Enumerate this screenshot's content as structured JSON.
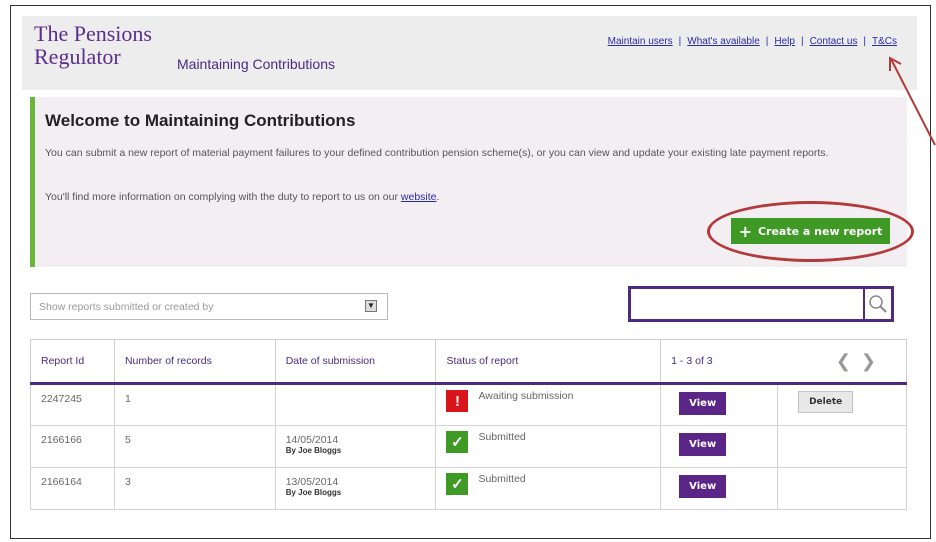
{
  "header": {
    "logo_line1": "The Pensions",
    "logo_line2": "Regulator",
    "app_title": "Maintaining Contributions",
    "links": [
      "Maintain users",
      "What's available",
      "Help",
      "Contact us",
      "T&Cs"
    ]
  },
  "welcome": {
    "title": "Welcome to Maintaining Contributions",
    "para1": "You can submit a new report of material payment failures to your defined contribution pension scheme(s), or you can view and update your existing late payment reports.",
    "para2_text": "You'll find more information on complying with the duty to report to us on our ",
    "para2_link": "website",
    "para2_end": ".",
    "create_button": "Create a new report"
  },
  "filter": {
    "placeholder": "Show reports submitted or created by"
  },
  "table": {
    "headers": [
      "Report Id",
      "Number of records",
      "Date of submission",
      "Status of report"
    ],
    "pager": "1 - 3 of 3",
    "rows": [
      {
        "id": "2247245",
        "records": "1",
        "date": "",
        "by": "",
        "status": "Awaiting submission",
        "status_type": "error",
        "view": "View",
        "delete": "Delete"
      },
      {
        "id": "2166166",
        "records": "5",
        "date": "14/05/2014",
        "by": "By Joe Bloggs",
        "status": "Submitted",
        "status_type": "ok",
        "view": "View"
      },
      {
        "id": "2166164",
        "records": "3",
        "date": "13/05/2014",
        "by": "By Joe Bloggs",
        "status": "Submitted",
        "status_type": "ok",
        "view": "View"
      }
    ]
  },
  "colors": {
    "brand_purple": "#4b2a7f",
    "accent_green": "#3e9a24",
    "alert_red": "#d9151b",
    "annotation_red": "#b33a3a"
  }
}
